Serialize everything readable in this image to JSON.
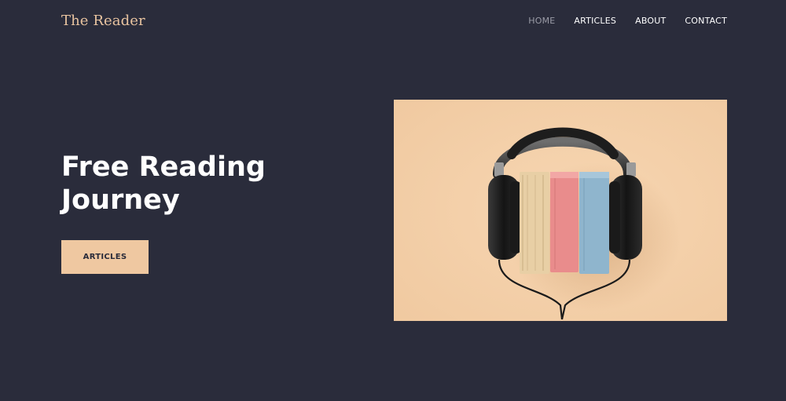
{
  "brand": {
    "name": "The Reader"
  },
  "nav": {
    "items": [
      {
        "label": "HOME",
        "active": true
      },
      {
        "label": "ARTICLES",
        "active": false
      },
      {
        "label": "ABOUT",
        "active": false
      },
      {
        "label": "CONTACT",
        "active": false
      }
    ]
  },
  "hero": {
    "title_line1": "Free Reading",
    "title_line2": "Journey",
    "button_label": "ARTICLES",
    "image_icon": "headphones-on-books-photo"
  },
  "colors": {
    "background": "#2a2c3b",
    "accent": "#efc8a1",
    "brand_text": "#e9c4a0",
    "nav_active": "#9a9ba6",
    "text": "#ffffff"
  }
}
